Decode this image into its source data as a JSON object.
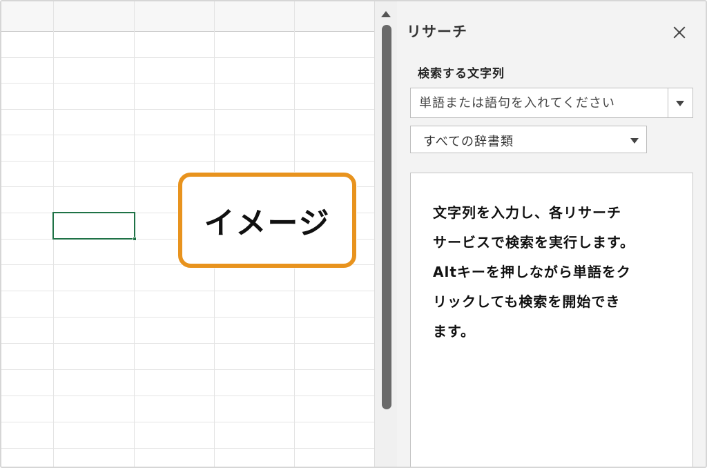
{
  "research_pane": {
    "title": "リサーチ",
    "search_label": "検索する文字列",
    "search_input": {
      "value": "",
      "placeholder": "単語または語句を入れてください"
    },
    "source_select": {
      "selected": "すべての辞書類"
    },
    "results": {
      "lines": [
        "文字列を入力し、各リサーチ",
        "サービスで検索を実行します。",
        "Altキーを押しながら単語をク",
        "リックしても検索を開始でき",
        "ます。"
      ]
    }
  },
  "callout": {
    "label": "イメージ"
  },
  "colors": {
    "accent_orange": "#e8931e",
    "active_cell_green": "#1f7246",
    "pane_background": "#f3f3f3"
  },
  "icons": {
    "close": "close-icon",
    "dropdown": "chevron-down-icon",
    "scroll_up": "scroll-up-icon"
  }
}
